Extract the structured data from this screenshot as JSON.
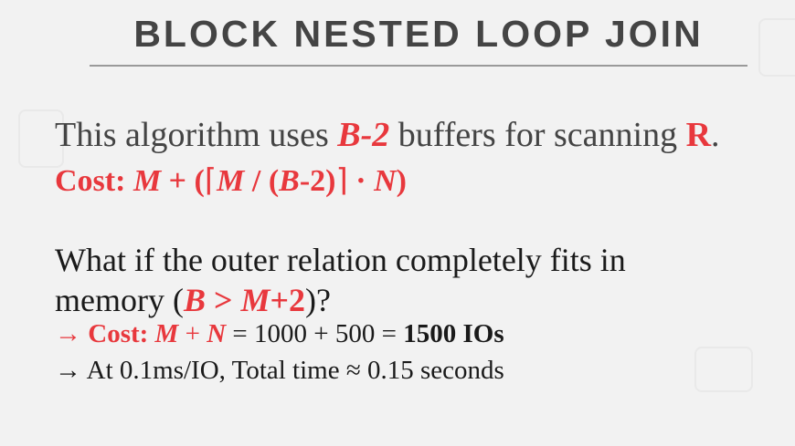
{
  "title": "BLOCK NESTED LOOP JOIN",
  "line1": {
    "prefix": "This algorithm uses ",
    "buffers": "B-2",
    "middle": " buffers for scanning ",
    "relation": "R",
    "suffix": "."
  },
  "line2": {
    "label": "Cost: ",
    "m1": "M",
    "plus": " + (",
    "lceil": "⌈",
    "m2": "M",
    "div": " / (",
    "b": "B",
    "minus2": "-2)",
    "rceil": "⌉",
    "dot": " · ",
    "n": "N",
    "close": ")"
  },
  "line3": {
    "text": "What if the outer relation completely fits in"
  },
  "line4": {
    "prefix": "memory (",
    "b": "B",
    "gt": " > ",
    "m": "M",
    "plus2": "+2",
    "suffix": ")?"
  },
  "line5": {
    "arrow": "→ ",
    "label": "Cost: ",
    "m": "M",
    "plus": " + ",
    "n": "N",
    "calc": " = 1000 + 500 = ",
    "result": "1500 IOs"
  },
  "line6": {
    "arrow": "→ ",
    "text": "At 0.1ms/IO, Total time ≈ 0.15 seconds"
  }
}
